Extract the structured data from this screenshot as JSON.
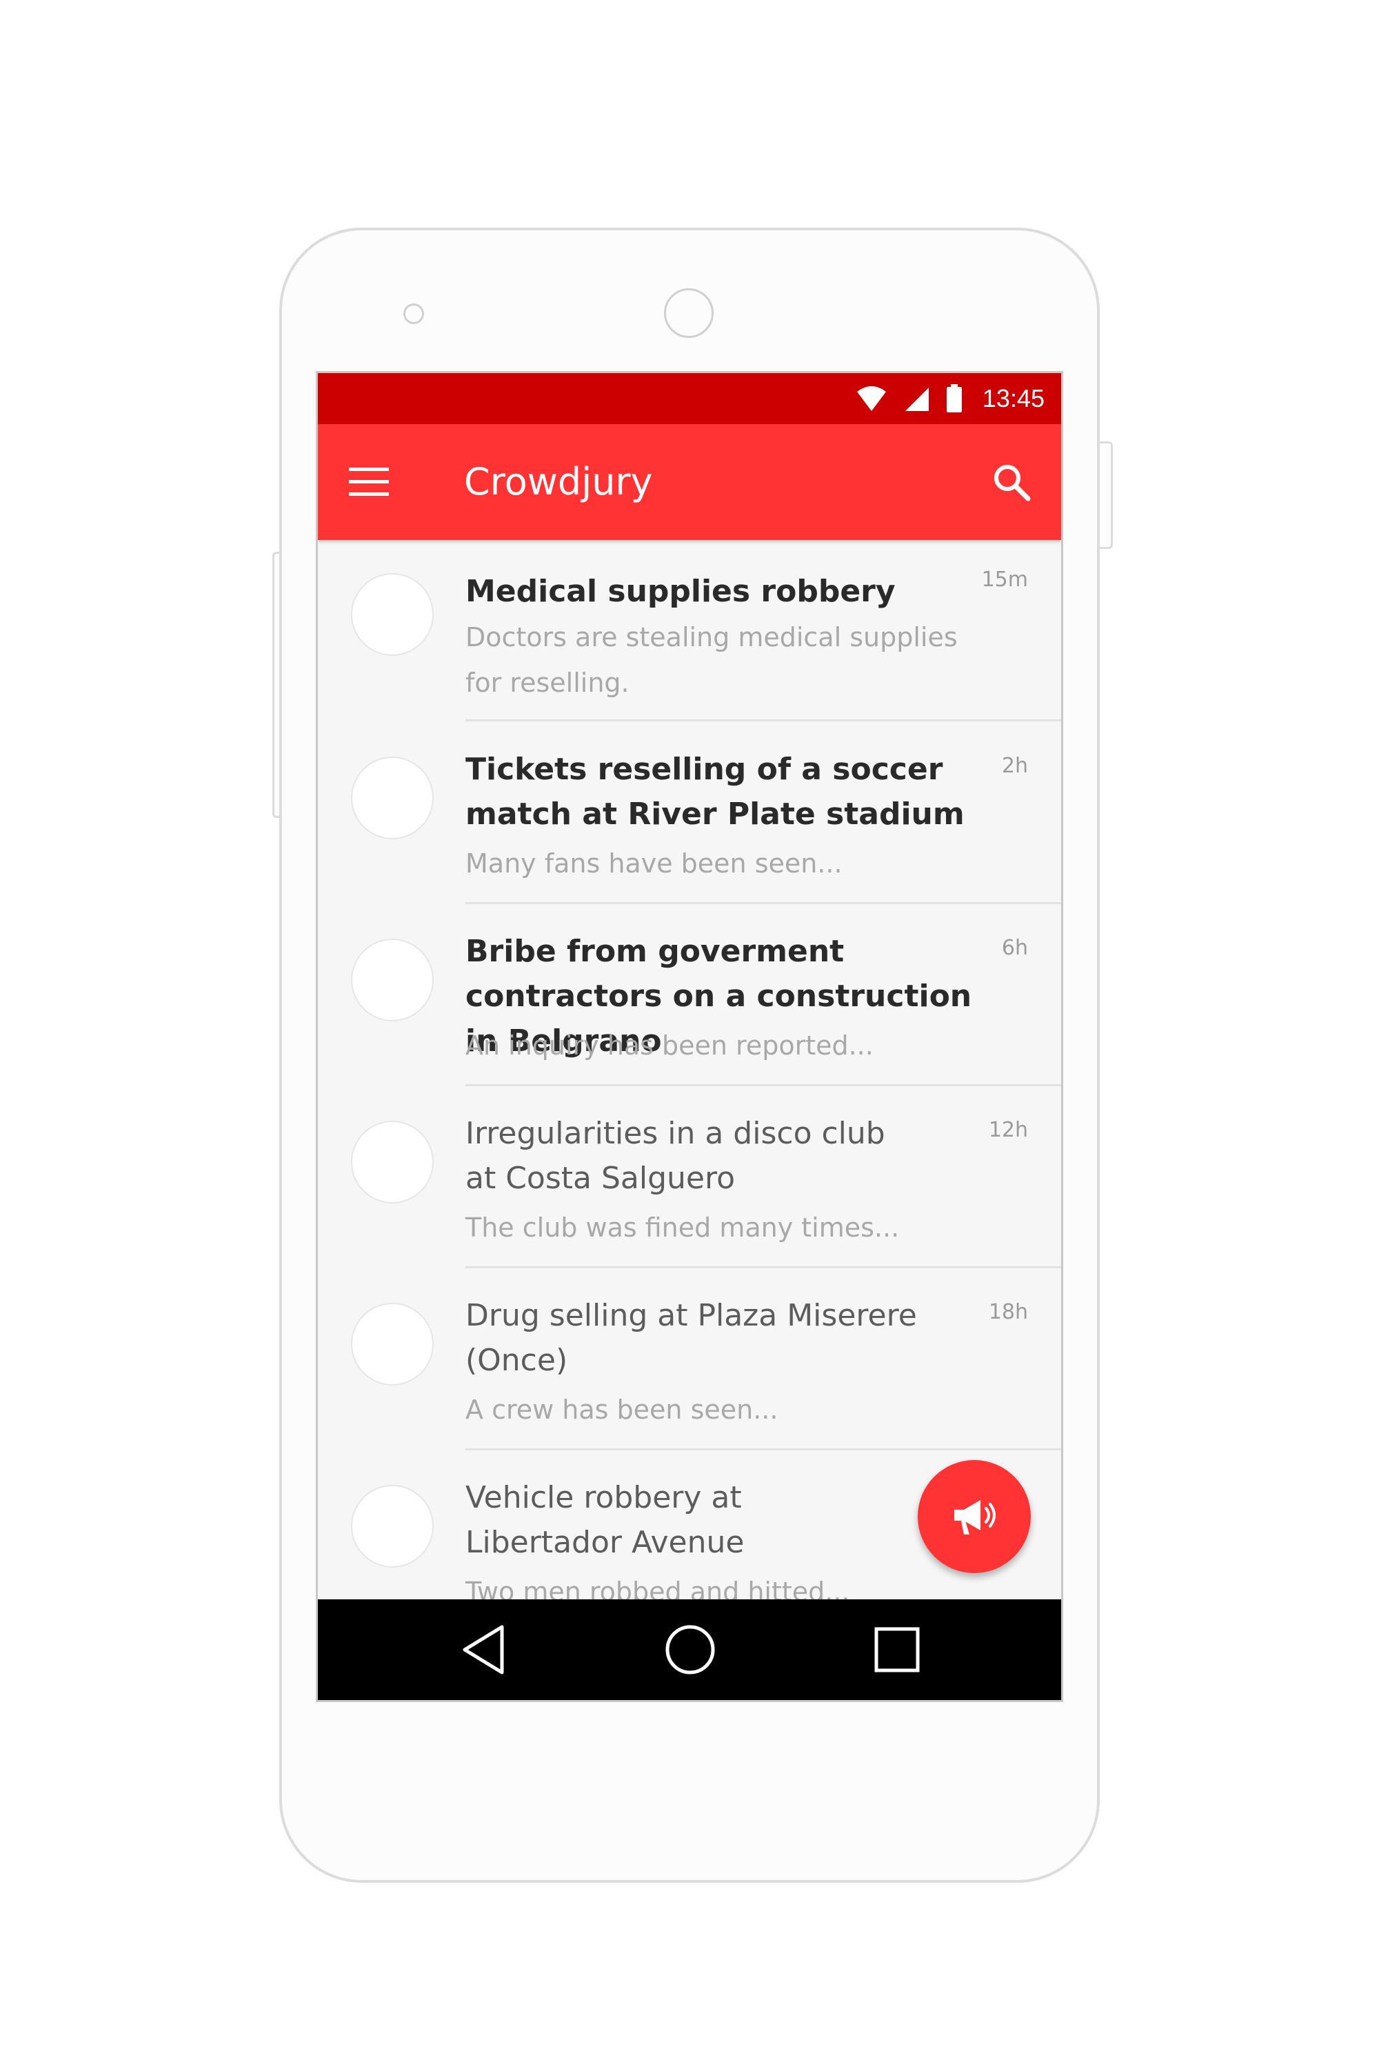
{
  "colors": {
    "status_bar": "#cc0000",
    "app_bar": "#ff3333",
    "fab": "#ff3333",
    "nav_bar": "#000000"
  },
  "status_bar": {
    "time": "13:45",
    "icons": [
      "wifi-icon",
      "signal-icon",
      "battery-icon"
    ]
  },
  "app_bar": {
    "title": "Crowdjury",
    "menu_icon": "hamburger-menu-icon",
    "search_icon": "search-icon"
  },
  "reports": [
    {
      "title": "Medical supplies robbery",
      "snippet": "Doctors are stealing medical supplies for reselling.",
      "time": "15m",
      "unread": true
    },
    {
      "title": "Tickets reselling of a soccer match at River Plate stadium",
      "snippet": "Many fans have been seen...",
      "time": "2h",
      "unread": true
    },
    {
      "title": "Bribe from goverment contractors on a construction in Belgrano",
      "snippet": "An inquiry has been reported...",
      "time": "6h",
      "unread": true
    },
    {
      "title": "Irregularities in a disco club at Costa Salguero",
      "snippet": "The club was fined many times...",
      "time": "12h",
      "unread": false
    },
    {
      "title": "Drug selling at Plaza Miserere (Once)",
      "snippet": "A crew has been seen...",
      "time": "18h",
      "unread": false
    },
    {
      "title": "Vehicle robbery at Libertador Avenue",
      "snippet": "Two men robbed and hitted...",
      "time": "",
      "unread": false
    }
  ],
  "fab": {
    "icon": "megaphone-icon"
  },
  "nav_bar": {
    "icons": [
      "back-icon",
      "home-icon",
      "recents-icon"
    ]
  }
}
